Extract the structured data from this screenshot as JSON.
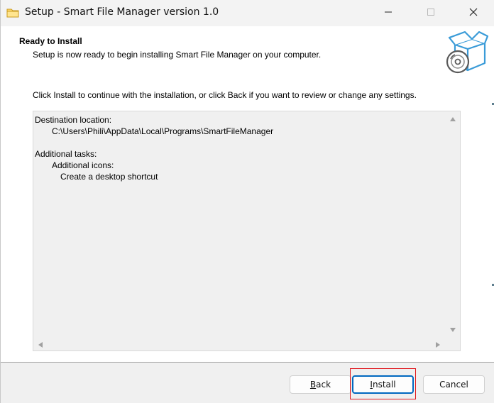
{
  "window": {
    "title": "Setup - Smart File Manager version 1.0"
  },
  "header": {
    "title": "Ready to Install",
    "subtitle": "Setup is now ready to begin installing Smart File Manager on your computer."
  },
  "body": {
    "instruction": "Click Install to continue with the installation, or click Back if you want to review or change any settings.",
    "memo": {
      "destination_label": "Destination location:",
      "destination_path": "C:\\Users\\Phili\\AppData\\Local\\Programs\\SmartFileManager",
      "tasks_label": "Additional tasks:",
      "icons_label": "Additional icons:",
      "shortcut_task": "Create a desktop shortcut"
    }
  },
  "buttons": {
    "back_prefix": "",
    "back_hotkey": "B",
    "back_rest": "ack",
    "install_hotkey": "I",
    "install_rest": "nstall",
    "cancel": "Cancel"
  },
  "icons": {
    "title": "folder-icon",
    "header": "install-box-disc-icon",
    "minimize": "minimize-icon",
    "maximize": "maximize-icon",
    "close": "close-icon"
  },
  "colors": {
    "accent": "#0067c0",
    "highlight": "#e0161c",
    "header_graphic": "#3a9bd8"
  }
}
